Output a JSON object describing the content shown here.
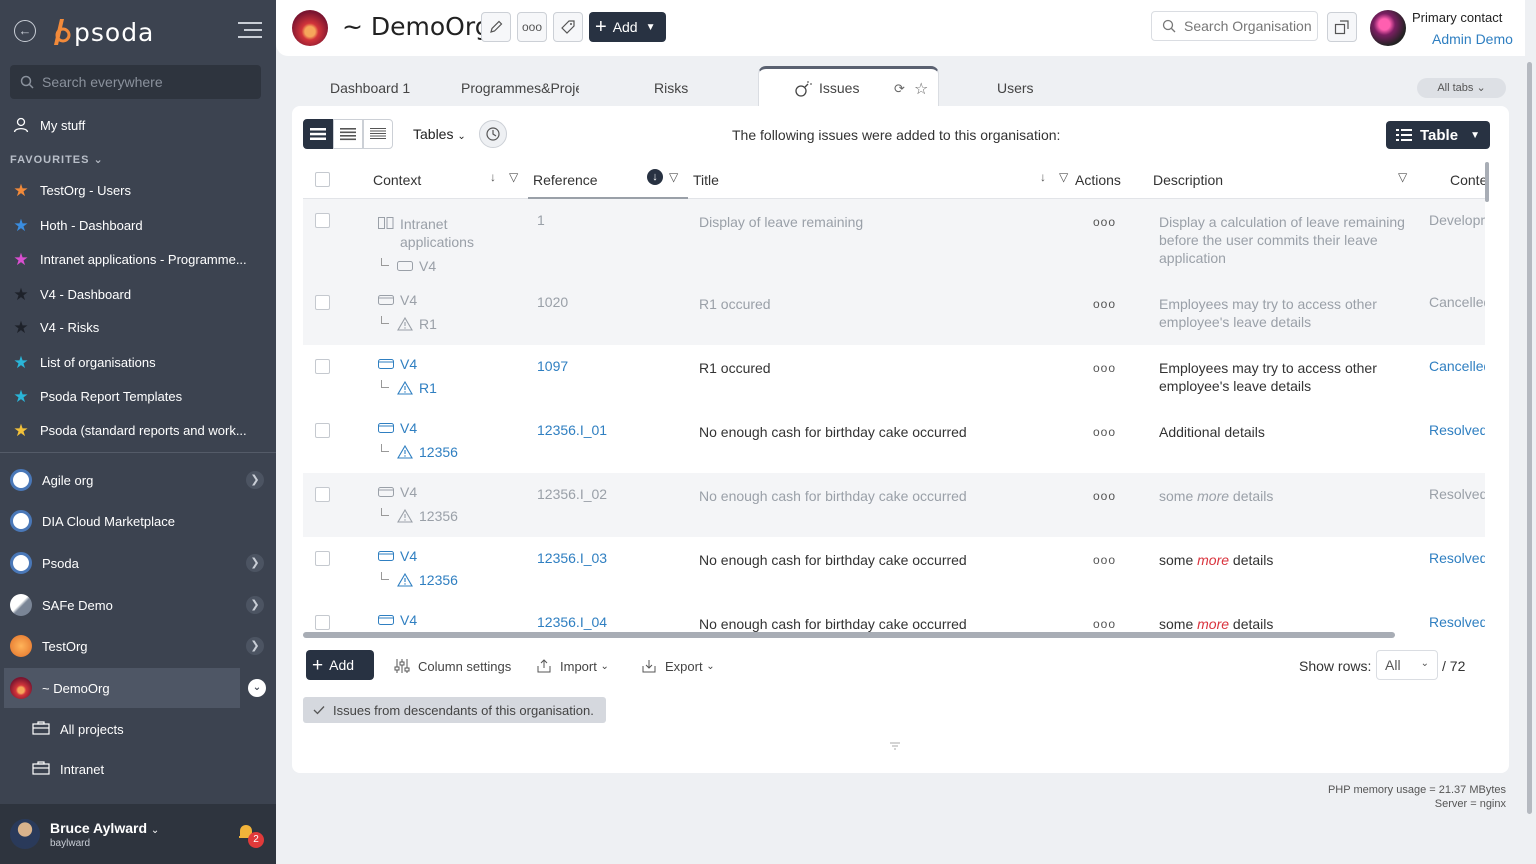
{
  "sidebar": {
    "logo": "psoda",
    "search_placeholder": "Search everywhere",
    "my_stuff": "My stuff",
    "favourites_label": "FAVOURITES",
    "favourites": [
      {
        "label": "TestOrg - Users",
        "color": "#f28a3a"
      },
      {
        "label": "Hoth - Dashboard",
        "color": "#3a8de0"
      },
      {
        "label": "Intranet applications - Programme...",
        "color": "#d94fd0"
      },
      {
        "label": "V4 - Dashboard",
        "color": "#222222"
      },
      {
        "label": "V4 - Risks",
        "color": "#222222"
      },
      {
        "label": "List of organisations",
        "color": "#2ab5d8"
      },
      {
        "label": "Psoda Report Templates",
        "color": "#2ab5d8"
      },
      {
        "label": "Psoda (standard reports and work...",
        "color": "#f2c13a"
      }
    ],
    "orgs": [
      {
        "label": "Agile org"
      },
      {
        "label": "DIA Cloud Marketplace"
      },
      {
        "label": "Psoda"
      },
      {
        "label": "SAFe Demo"
      },
      {
        "label": "TestOrg"
      },
      {
        "label": "~ DemoOrg"
      }
    ],
    "sub_items": [
      "All projects",
      "Intranet"
    ],
    "user": {
      "name": "Bruce Aylward",
      "login": "baylward",
      "notifications": "2"
    }
  },
  "header": {
    "org_title": "~ DemoOrg",
    "add_label": "Add",
    "search_placeholder": "Search Organisation",
    "contact_label": "Primary contact",
    "contact_name": "Admin Demo"
  },
  "tabs": {
    "items": [
      "Dashboard 1",
      "Programmes&Proje",
      "Risks",
      "Issues",
      "Users"
    ],
    "active": "Issues",
    "all_tabs": "All tabs"
  },
  "toolbar": {
    "tables_label": "Tables",
    "intro": "The following issues were added to this organisation:",
    "table_btn": "Table"
  },
  "columns": [
    "Context",
    "Reference",
    "Title",
    "Actions",
    "Description",
    "Context C"
  ],
  "rows": [
    {
      "ctx_top": "Intranet applications",
      "ctx_child": "V4",
      "ref": "1",
      "title": "Display of leave remaining",
      "desc": "Display a calculation of leave remaining before the user commits their leave application",
      "status": "Developm",
      "faded": true
    },
    {
      "ctx_top": "V4",
      "ctx_child": "R1",
      "ref": "1020",
      "title": "R1 occured",
      "desc": "Employees may try to access other employee's leave details",
      "status": "Cancelled",
      "faded": true
    },
    {
      "ctx_top": "V4",
      "ctx_child": "R1",
      "ref": "1097",
      "title": "R1 occured",
      "desc": "Employees may try to access other employee's leave details",
      "status": "Cancelled",
      "faded": false
    },
    {
      "ctx_top": "V4",
      "ctx_child": "12356",
      "ref": "12356.I_01",
      "title": "No enough cash for birthday cake occurred",
      "desc": "Additional details",
      "status": "Resolved",
      "faded": false
    },
    {
      "ctx_top": "V4",
      "ctx_child": "12356",
      "ref": "12356.I_02",
      "title": "No enough cash for birthday cake occurred",
      "desc_pre": "some",
      "desc_em": "more",
      "desc_post": "details",
      "status": "Resolved",
      "faded": true
    },
    {
      "ctx_top": "V4",
      "ctx_child": "12356",
      "ref": "12356.I_03",
      "title": "No enough cash for birthday cake occurred",
      "desc_pre": "some",
      "desc_em": "more",
      "desc_post": "details",
      "status": "Resolved",
      "faded": false
    },
    {
      "ctx_top": "V4",
      "ctx_child": "",
      "ref": "12356.I_04",
      "title": "No enough cash for birthday cake occurred",
      "desc_pre": "some",
      "desc_em": "more",
      "desc_post": "details",
      "status": "Resolved",
      "faded": false
    }
  ],
  "actions_glyph": "ooo",
  "footer": {
    "add_label": "Add",
    "column_settings": "Column settings",
    "import": "Import",
    "export": "Export",
    "show_rows_label": "Show rows:",
    "show_rows_value": "All",
    "total": "/ 72",
    "descendants": "Issues from descendants of this organisation."
  },
  "system": {
    "memory": "PHP memory usage = 21.37 MBytes",
    "server": "Server = nginx"
  }
}
